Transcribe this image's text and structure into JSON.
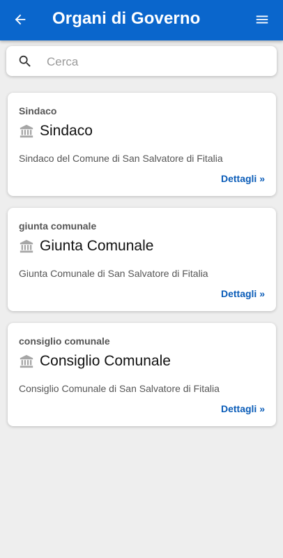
{
  "header": {
    "title": "Organi di Governo",
    "back_icon": "arrow-left-icon",
    "menu_icon": "hamburger-menu-icon",
    "background_color": "#0a66cc"
  },
  "search": {
    "placeholder": "Cerca",
    "value": "",
    "icon": "search-icon"
  },
  "cards": [
    {
      "category": "Sindaco",
      "icon": "building-icon",
      "title": "Sindaco",
      "description": "Sindaco del Comune di San Salvatore di Fitalia",
      "link_label": "Dettagli »"
    },
    {
      "category": "giunta comunale",
      "icon": "building-icon",
      "title": "Giunta Comunale",
      "description": "Giunta Comunale di San Salvatore di Fitalia",
      "link_label": "Dettagli »"
    },
    {
      "category": "consiglio comunale",
      "icon": "building-icon",
      "title": "Consiglio Comunale",
      "description": "Consiglio Comunale di San Salvatore di Fitalia",
      "link_label": "Dettagli »"
    }
  ],
  "colors": {
    "link": "#0a5cb8",
    "page_background": "#eeeeee"
  }
}
